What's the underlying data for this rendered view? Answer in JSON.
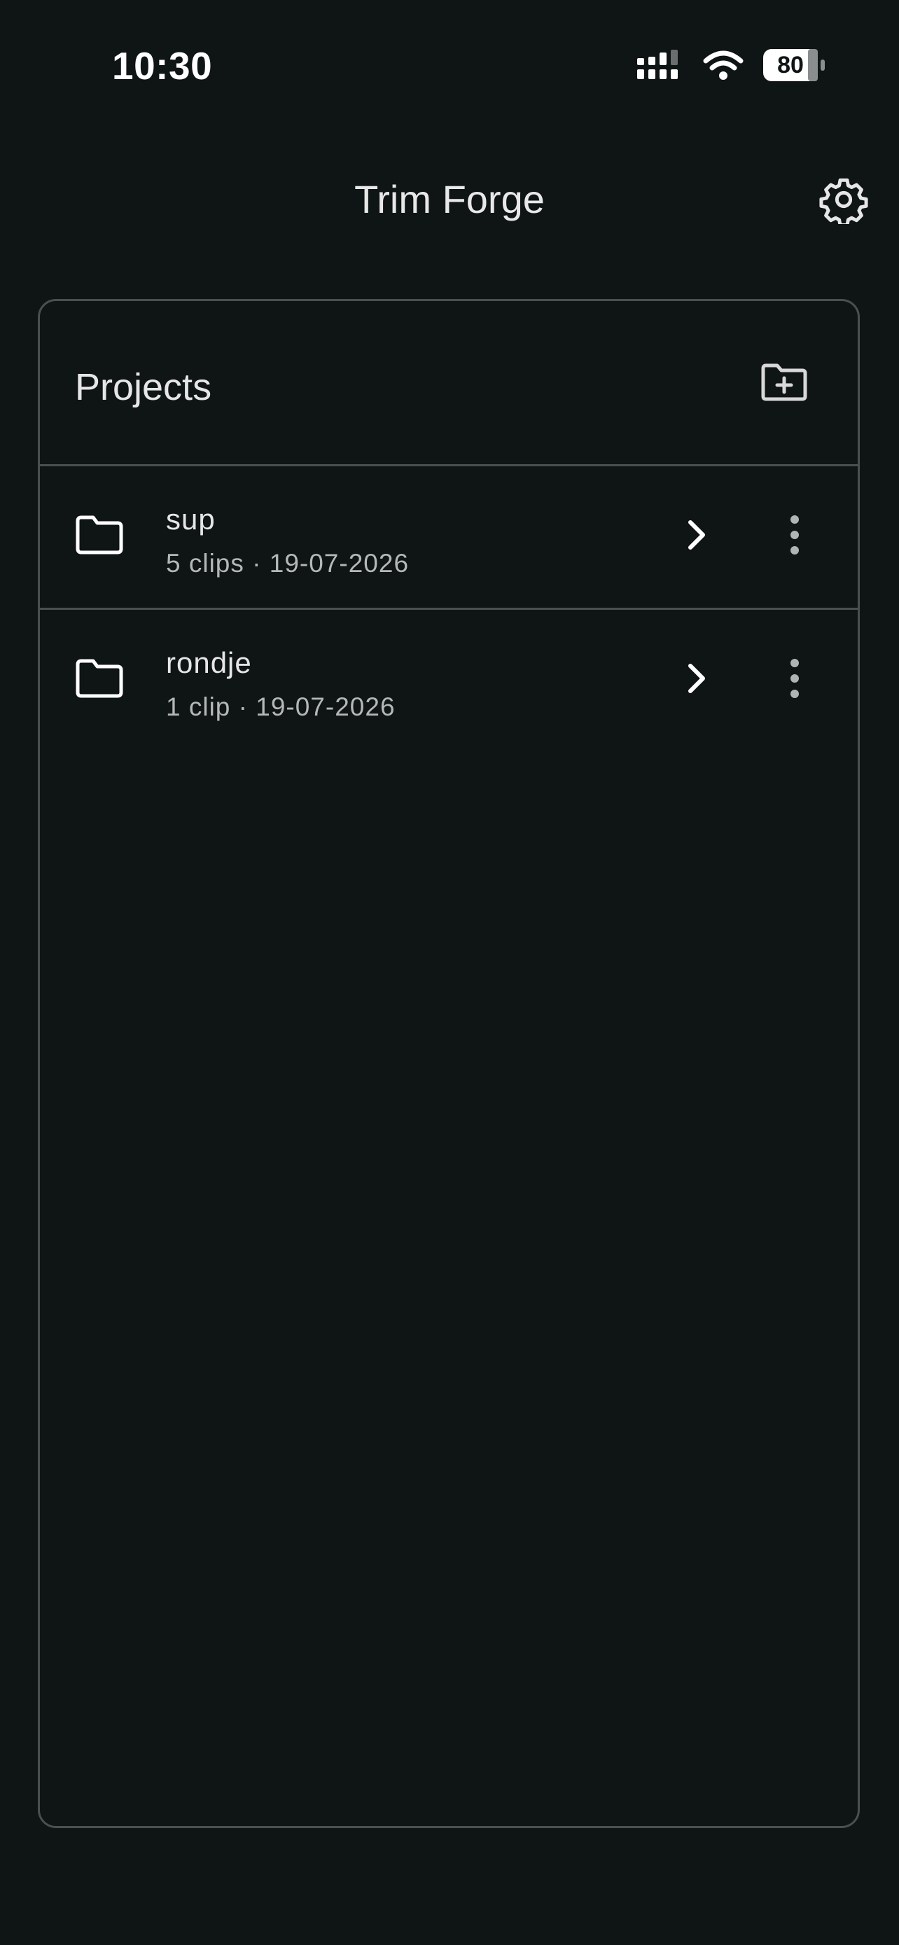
{
  "status_bar": {
    "time": "10:30",
    "battery": "80",
    "icons": [
      "signal-icon",
      "wifi-icon",
      "battery-icon"
    ]
  },
  "header": {
    "title": "Trim Forge",
    "settings_icon": "gear-icon"
  },
  "projects": {
    "title": "Projects",
    "add_icon": "new-folder-icon",
    "items": [
      {
        "name": "sup",
        "meta": "5 clips · 19-07-2026"
      },
      {
        "name": "rondje",
        "meta": "1 clip · 19-07-2026"
      }
    ]
  },
  "colors": {
    "background": "#0f1414",
    "border": "#4a4f4f",
    "text": "#e6e6e6",
    "muted_text": "#b5b8b8"
  }
}
